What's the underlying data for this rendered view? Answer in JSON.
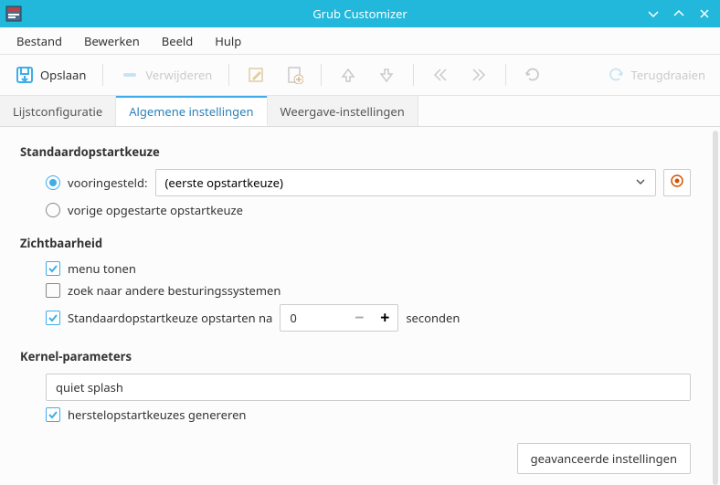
{
  "window": {
    "title": "Grub Customizer"
  },
  "menu": {
    "file": "Bestand",
    "edit": "Bewerken",
    "view": "Beeld",
    "help": "Hulp"
  },
  "toolbar": {
    "save": "Opslaan",
    "remove": "Verwijderen",
    "revert": "Terugdraaien"
  },
  "tabs": {
    "list": "Lijstconfiguratie",
    "general": "Algemene instellingen",
    "display": "Weergave-instellingen"
  },
  "boot": {
    "section": "Standaardopstartkeuze",
    "preset_label": "vooringesteld:",
    "select_value": "(eerste opstartkeuze)",
    "previous_label": "vorige opgestarte opstartkeuze"
  },
  "visibility": {
    "section": "Zichtbaarheid",
    "show_menu": "menu tonen",
    "probe_os": "zoek naar andere besturingssystemen",
    "timeout_label": "Standaardopstartkeuze opstarten na",
    "timeout_value": "0",
    "timeout_unit": "seconden"
  },
  "kernel": {
    "section": "Kernel-parameters",
    "params_value": "quiet splash",
    "recovery_label": "herstelopstartkeuzes genereren"
  },
  "footer": {
    "advanced": "geavanceerde instellingen"
  }
}
